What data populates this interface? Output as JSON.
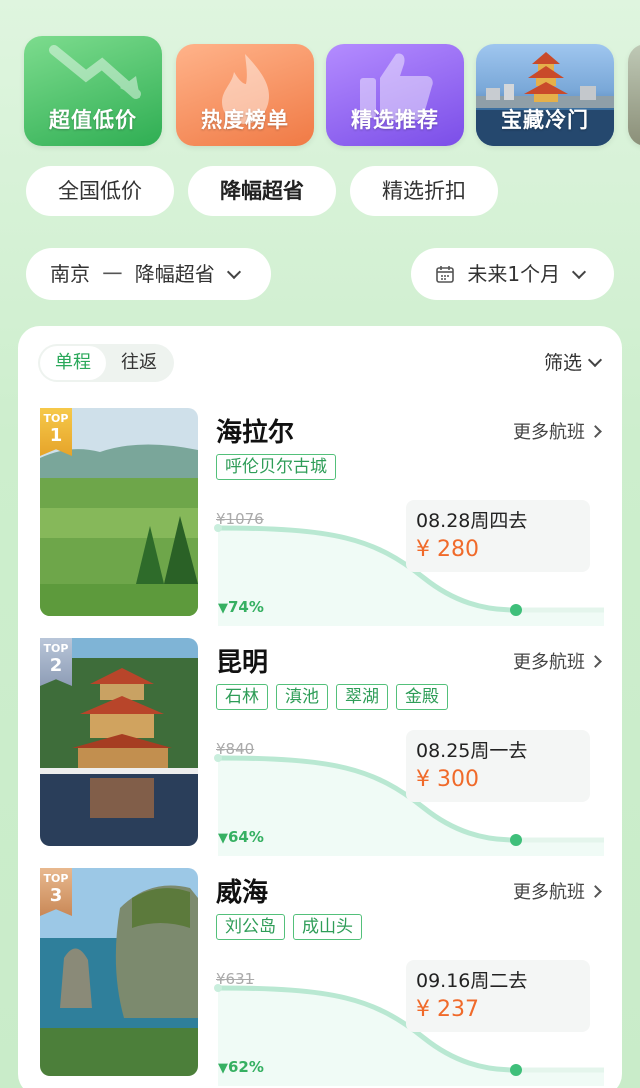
{
  "categories": [
    {
      "label": "超值低价",
      "icon": "trend-down-icon"
    },
    {
      "label": "热度榜单",
      "icon": "flame-icon"
    },
    {
      "label": "精选推荐",
      "icon": "thumbs-up-icon"
    },
    {
      "label": "宝藏冷门",
      "icon": "pagoda-photo"
    }
  ],
  "tabs": [
    "全国低价",
    "降幅超省",
    "精选折扣"
  ],
  "route_selector": {
    "from": "南京",
    "separator": "一",
    "mode": "降幅超省"
  },
  "date_selector": {
    "label": "未来1个月",
    "icon": "calendar-icon"
  },
  "trip_toggle": {
    "one_way": "单程",
    "round_trip": "往返"
  },
  "filter_label": "筛选",
  "destinations": [
    {
      "rank_top": "TOP",
      "rank_num": "1",
      "name": "海拉尔",
      "more": "更多航班",
      "tags": [
        "呼伦贝尔古城"
      ],
      "old_price": "¥1076",
      "drop": "74%",
      "date": "08.28周四去",
      "price": "¥ 280"
    },
    {
      "rank_top": "TOP",
      "rank_num": "2",
      "name": "昆明",
      "more": "更多航班",
      "tags": [
        "石林",
        "滇池",
        "翠湖",
        "金殿"
      ],
      "old_price": "¥840",
      "drop": "64%",
      "date": "08.25周一去",
      "price": "¥ 300"
    },
    {
      "rank_top": "TOP",
      "rank_num": "3",
      "name": "威海",
      "more": "更多航班",
      "tags": [
        "刘公岛",
        "成山头"
      ],
      "old_price": "¥631",
      "drop": "62%",
      "date": "09.16周二去",
      "price": "¥ 237"
    }
  ],
  "colors": {
    "accent_green": "#2aa85a",
    "price_orange": "#f06a2a",
    "tag_green": "#53c07a"
  }
}
